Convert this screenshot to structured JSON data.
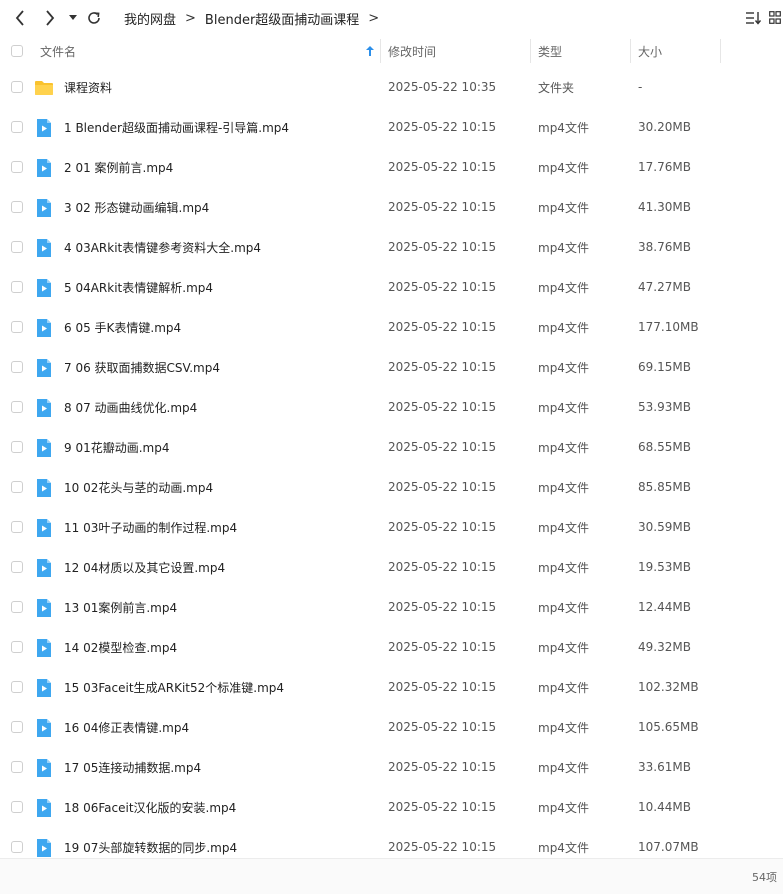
{
  "breadcrumb": [
    "我的网盘",
    "Blender超级面捕动画课程"
  ],
  "columns": {
    "name": "文件名",
    "modified": "修改时间",
    "type": "类型",
    "size": "大小"
  },
  "rows": [
    {
      "kind": "folder",
      "name": "课程资料",
      "modified": "2025-05-22 10:35",
      "type": "文件夹",
      "size": "-"
    },
    {
      "kind": "video",
      "name": "1 Blender超级面捕动画课程-引导篇.mp4",
      "modified": "2025-05-22 10:15",
      "type": "mp4文件",
      "size": "30.20MB"
    },
    {
      "kind": "video",
      "name": "2 01 案例前言.mp4",
      "modified": "2025-05-22 10:15",
      "type": "mp4文件",
      "size": "17.76MB"
    },
    {
      "kind": "video",
      "name": "3 02 形态键动画编辑.mp4",
      "modified": "2025-05-22 10:15",
      "type": "mp4文件",
      "size": "41.30MB"
    },
    {
      "kind": "video",
      "name": "4 03ARkit表情键参考资料大全.mp4",
      "modified": "2025-05-22 10:15",
      "type": "mp4文件",
      "size": "38.76MB"
    },
    {
      "kind": "video",
      "name": "5 04ARkit表情键解析.mp4",
      "modified": "2025-05-22 10:15",
      "type": "mp4文件",
      "size": "47.27MB"
    },
    {
      "kind": "video",
      "name": "6 05 手K表情键.mp4",
      "modified": "2025-05-22 10:15",
      "type": "mp4文件",
      "size": "177.10MB"
    },
    {
      "kind": "video",
      "name": "7 06 获取面捕数据CSV.mp4",
      "modified": "2025-05-22 10:15",
      "type": "mp4文件",
      "size": "69.15MB"
    },
    {
      "kind": "video",
      "name": "8 07 动画曲线优化.mp4",
      "modified": "2025-05-22 10:15",
      "type": "mp4文件",
      "size": "53.93MB"
    },
    {
      "kind": "video",
      "name": "9 01花瓣动画.mp4",
      "modified": "2025-05-22 10:15",
      "type": "mp4文件",
      "size": "68.55MB"
    },
    {
      "kind": "video",
      "name": "10 02花头与茎的动画.mp4",
      "modified": "2025-05-22 10:15",
      "type": "mp4文件",
      "size": "85.85MB"
    },
    {
      "kind": "video",
      "name": "11 03叶子动画的制作过程.mp4",
      "modified": "2025-05-22 10:15",
      "type": "mp4文件",
      "size": "30.59MB"
    },
    {
      "kind": "video",
      "name": "12 04材质以及其它设置.mp4",
      "modified": "2025-05-22 10:15",
      "type": "mp4文件",
      "size": "19.53MB"
    },
    {
      "kind": "video",
      "name": "13 01案例前言.mp4",
      "modified": "2025-05-22 10:15",
      "type": "mp4文件",
      "size": "12.44MB"
    },
    {
      "kind": "video",
      "name": "14 02模型检查.mp4",
      "modified": "2025-05-22 10:15",
      "type": "mp4文件",
      "size": "49.32MB"
    },
    {
      "kind": "video",
      "name": "15 03Faceit生成ARKit52个标准键.mp4",
      "modified": "2025-05-22 10:15",
      "type": "mp4文件",
      "size": "102.32MB"
    },
    {
      "kind": "video",
      "name": "16 04修正表情键.mp4",
      "modified": "2025-05-22 10:15",
      "type": "mp4文件",
      "size": "105.65MB"
    },
    {
      "kind": "video",
      "name": "17 05连接动捕数据.mp4",
      "modified": "2025-05-22 10:15",
      "type": "mp4文件",
      "size": "33.61MB"
    },
    {
      "kind": "video",
      "name": "18 06Faceit汉化版的安装.mp4",
      "modified": "2025-05-22 10:15",
      "type": "mp4文件",
      "size": "10.44MB"
    },
    {
      "kind": "video",
      "name": "19 07头部旋转数据的同步.mp4",
      "modified": "2025-05-22 10:15",
      "type": "mp4文件",
      "size": "107.07MB"
    }
  ],
  "footer": {
    "count": "54项"
  },
  "icons": {
    "back": "chevron-left-icon",
    "forward": "chevron-right-icon",
    "history": "caret-down-icon",
    "refresh": "refresh-icon",
    "sort": "sort-icon",
    "view": "grid-view-icon",
    "sort_indicator": "arrow-up-icon",
    "folder": "folder-icon",
    "video": "video-file-icon"
  },
  "colors": {
    "folder": "#F9C22E",
    "video": "#3EA7F0",
    "accent": "#2C8FEA"
  }
}
